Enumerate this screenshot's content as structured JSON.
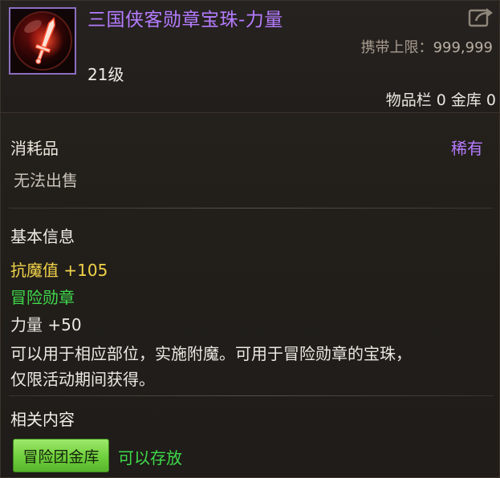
{
  "item": {
    "name": "三国侠客勋章宝珠-力量",
    "level": "21级",
    "icon": "sword-orb-icon",
    "carry_limit_label": "携带上限：",
    "carry_limit_value": "999,999",
    "storage_text": "物品栏 0 金库 0"
  },
  "category": {
    "type": "消耗品",
    "rarity": "稀有",
    "sell_status": "无法出售"
  },
  "basic_info": {
    "title": "基本信息",
    "stat_magic_resist": "抗魔值 +105",
    "medal_label": "冒险勋章",
    "stat_strength": "力量 +50",
    "description_line1": "可以用于相应部位，实施附魔。可用于冒险勋章的宝珠，",
    "description_line2": "仅限活动期间获得。"
  },
  "related": {
    "title": "相关内容",
    "warehouse_button": "冒险团金库",
    "storable_text": "可以存放"
  },
  "colors": {
    "rarity_purple": "#b57cff",
    "stat_yellow": "#f2d34a",
    "medal_green": "#3fd94a",
    "button_green": "#6fcf3d"
  },
  "icons": [
    "sword-orb-icon",
    "share-icon"
  ]
}
